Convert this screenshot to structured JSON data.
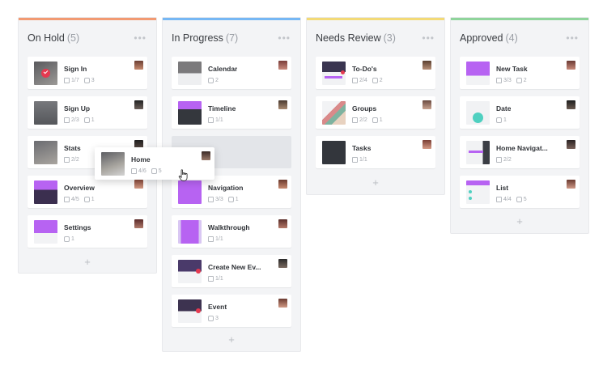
{
  "columns": [
    {
      "title": "On Hold",
      "count": "(5)",
      "color": "#f29a72",
      "cards": [
        {
          "title": "Sign In",
          "checks": "1/7",
          "comments": "3"
        },
        {
          "title": "Sign Up",
          "checks": "2/3",
          "comments": "1"
        },
        {
          "title": "Stats",
          "checks": "2/2",
          "comments": ""
        },
        {
          "title": "Overview",
          "checks": "4/5",
          "comments": "1"
        },
        {
          "title": "Settings",
          "checks": "",
          "comments": "1"
        }
      ]
    },
    {
      "title": "In Progress",
      "count": "(7)",
      "color": "#76b7f4",
      "cards": [
        {
          "title": "Calendar",
          "checks": "",
          "comments": "2"
        },
        {
          "title": "Timeline",
          "checks": "1/1",
          "comments": ""
        },
        {
          "title": "Navigation",
          "checks": "3/3",
          "comments": "1"
        },
        {
          "title": "Walkthrough",
          "checks": "1/1",
          "comments": ""
        },
        {
          "title": "Create New Ev...",
          "checks": "1/1",
          "comments": ""
        },
        {
          "title": "Event",
          "checks": "",
          "comments": "3"
        }
      ]
    },
    {
      "title": "Needs Review",
      "count": "(3)",
      "color": "#f3da76",
      "cards": [
        {
          "title": "To-Do's",
          "checks": "2/4",
          "comments": "2"
        },
        {
          "title": "Groups",
          "checks": "2/2",
          "comments": "1"
        },
        {
          "title": "Tasks",
          "checks": "1/1",
          "comments": ""
        }
      ]
    },
    {
      "title": "Approved",
      "count": "(4)",
      "color": "#8fd49b",
      "cards": [
        {
          "title": "New Task",
          "checks": "3/3",
          "comments": "2"
        },
        {
          "title": "Date",
          "checks": "",
          "comments": "1"
        },
        {
          "title": "Home Navigat...",
          "checks": "2/2",
          "comments": ""
        },
        {
          "title": "List",
          "checks": "4/4",
          "comments": "5"
        }
      ]
    }
  ],
  "dragging_card": {
    "title": "Home",
    "checks": "4/6",
    "comments": "5"
  },
  "add_label": "+",
  "menu_label": "•••",
  "accent_purple": "#b763f2",
  "accent_red": "#e53950"
}
